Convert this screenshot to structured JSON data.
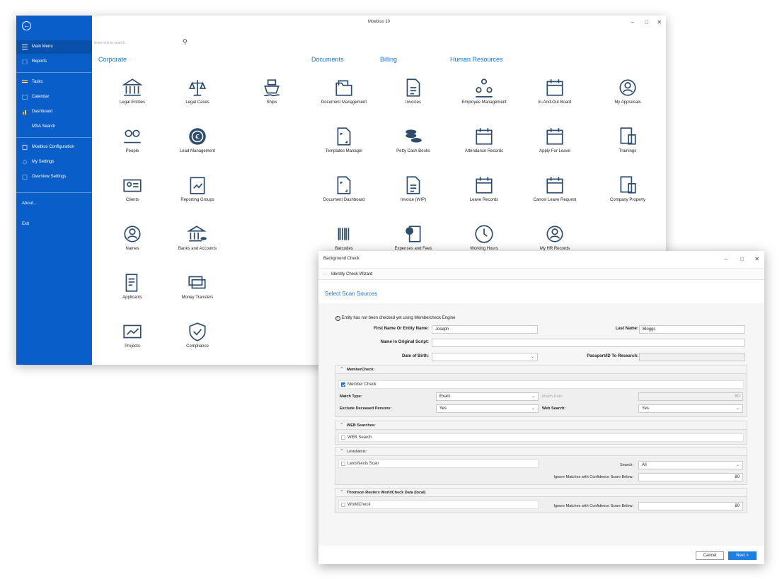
{
  "main_window": {
    "title": "Moebius 10",
    "search_placeholder": "Enter text to search...",
    "sidebar": {
      "items": [
        {
          "label": "Main Menu"
        },
        {
          "label": "Reports"
        },
        {
          "label": "Tasks"
        },
        {
          "label": "Calendar"
        },
        {
          "label": "Dashboard"
        },
        {
          "label": "MSA Search"
        },
        {
          "label": "Moebius Configuration"
        },
        {
          "label": "My Settings"
        },
        {
          "label": "Overview Settings"
        },
        {
          "label": "About..."
        },
        {
          "label": "Exit"
        }
      ]
    },
    "sections": [
      "Corporate",
      "Documents",
      "Billing",
      "Human Resources"
    ],
    "tiles": [
      {
        "label": "Legal Entities",
        "icon": "bank-icon"
      },
      {
        "label": "Legal Cases",
        "icon": "scales-icon"
      },
      {
        "label": "Ships",
        "icon": "ship-icon"
      },
      {
        "label": "Document Management",
        "icon": "folder-icon"
      },
      {
        "label": "Invoices",
        "icon": "invoice-icon"
      },
      {
        "label": "Employee Management",
        "icon": "org-chart-icon"
      },
      {
        "label": "In-And-Out Board",
        "icon": "calendar-icon"
      },
      {
        "label": "My Appraisals",
        "icon": "appraisal-icon"
      },
      {
        "label": "People",
        "icon": "people-icon"
      },
      {
        "label": "Lead Management",
        "icon": "euro-coin-icon"
      },
      {
        "label": "Templates Manager",
        "icon": "template-icon"
      },
      {
        "label": "Petty Cash Books",
        "icon": "coins-icon"
      },
      {
        "label": "Attendance Records",
        "icon": "attendance-icon"
      },
      {
        "label": "Apply For Leave",
        "icon": "leave-calendar-icon"
      },
      {
        "label": "Trainings",
        "icon": "training-icon"
      },
      {
        "label": "Clients",
        "icon": "client-card-icon"
      },
      {
        "label": "Reporting Groups",
        "icon": "report-clipboard-icon"
      },
      {
        "label": "Document Dashboard",
        "icon": "document-gauge-icon"
      },
      {
        "label": "Invoice (WIP)",
        "icon": "invoice-add-icon"
      },
      {
        "label": "Leave Records",
        "icon": "leave-records-icon"
      },
      {
        "label": "Cancel Leave Request",
        "icon": "cancel-leave-icon"
      },
      {
        "label": "Company Property",
        "icon": "property-icon"
      },
      {
        "label": "Names",
        "icon": "names-icon"
      },
      {
        "label": "Banks and Accounts",
        "icon": "bank-accounts-icon"
      },
      {
        "label": "Barcodes",
        "icon": "barcode-icon"
      },
      {
        "label": "Expenses and Fees",
        "icon": "expenses-icon"
      },
      {
        "label": "Working Hours",
        "icon": "clock-icon"
      },
      {
        "label": "My HR Records",
        "icon": "hr-records-icon"
      },
      {
        "label": "Applicants",
        "icon": "applicants-icon"
      },
      {
        "label": "Money Transfers",
        "icon": "money-transfer-icon"
      },
      {
        "label": "Projects",
        "icon": "projects-icon"
      },
      {
        "label": "Compliance",
        "icon": "compliance-icon"
      }
    ],
    "brand_color": "#0a5ec7",
    "icon_color": "#2f4c6b"
  },
  "dialog": {
    "title": "Background Check",
    "wizard": "Identity Check Wizard",
    "heading": "Select Scan Sources",
    "info": "Entity has not been checked yet using Membercheck Engine",
    "fields": {
      "first_name_label": "First Name Or Entity Name:",
      "first_name_value": "Joseph",
      "last_name_label": "Last Name:",
      "last_name_value": "Bloggs",
      "original_script_label": "Name in Original Script:",
      "original_script_value": "",
      "dob_label": "Date of Birth:",
      "dob_value": "",
      "passport_label": "Passport/ID To Research:",
      "passport_value": ""
    },
    "membercheck": {
      "title": "MemberCheck:",
      "checkbox_label": "Member Check",
      "checked": true,
      "match_type_label": "Match Type:",
      "match_type_value": "Exact",
      "match_rate_label": "Match Rate:",
      "match_rate_value": "80",
      "exclude_label": "Exclude Deceased Persons:",
      "exclude_value": "Yes",
      "web_search_label": "Web Search:",
      "web_search_value": "Yes"
    },
    "web_searches": {
      "title": "WEB Searches:",
      "checkbox_label": "WEB Search",
      "checked": false
    },
    "lexisnexis": {
      "title": "LexisNexis:",
      "checkbox_label": "LexisNexis Scan",
      "checked": false,
      "search_label": "Search:",
      "search_value": "All",
      "ignore_label": "Ignore Matches with Confidence Score Below:",
      "ignore_value": "80"
    },
    "worldcheck": {
      "title": "Thomson Reuters WorldCheck Data (local)",
      "checkbox_label": "WorldCheck",
      "checked": false,
      "ignore_label": "Ignore Matches with Confidence Score Below:",
      "ignore_value": "80"
    },
    "buttons": {
      "cancel": "Cancel",
      "next": "Next >"
    },
    "accent_color": "#1f7fe0"
  }
}
